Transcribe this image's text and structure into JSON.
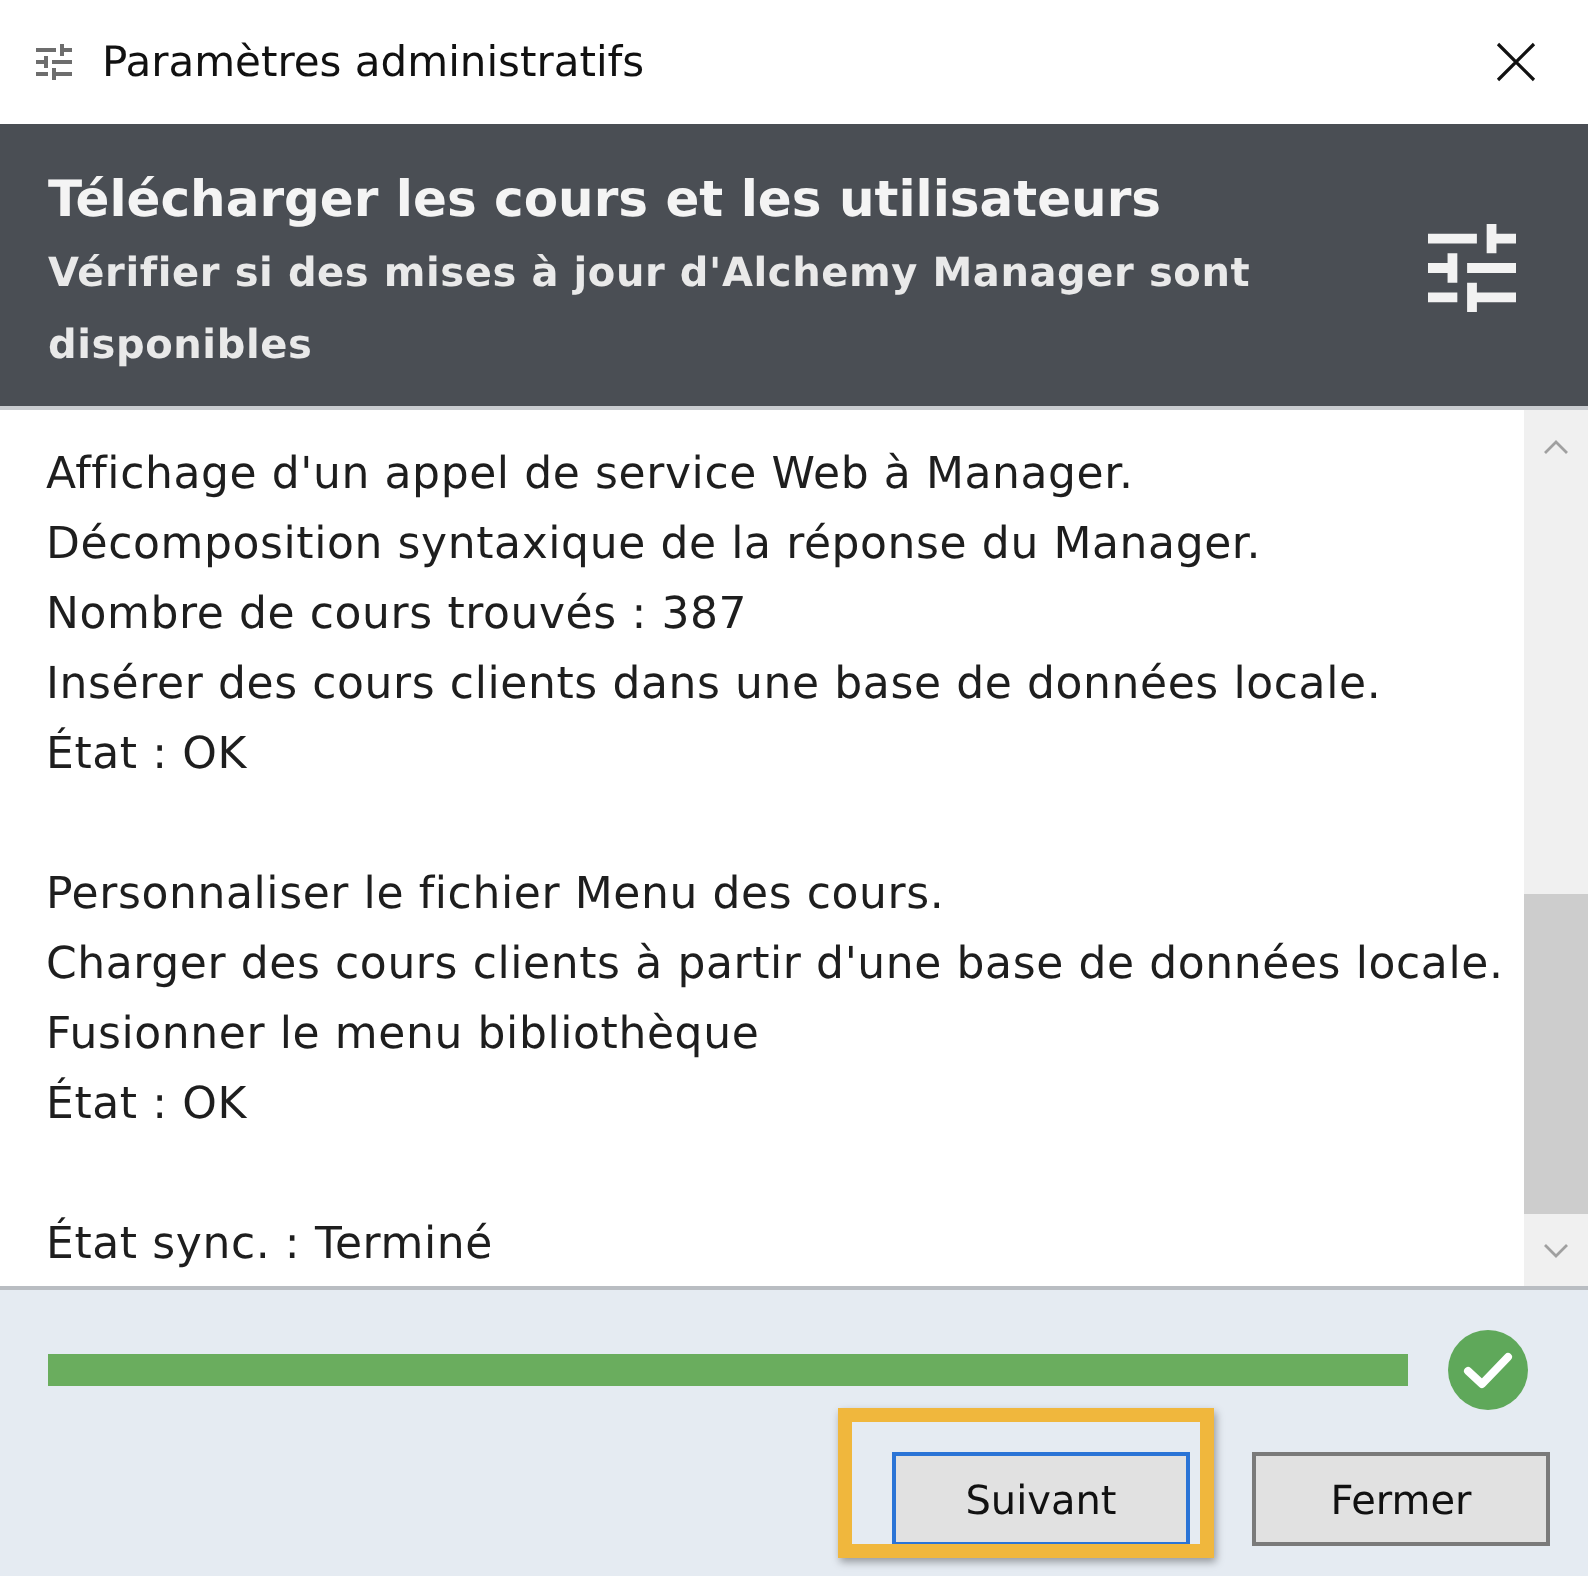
{
  "window": {
    "title": "Paramètres administratifs"
  },
  "header": {
    "title": "Télécharger les cours et les utilisateurs",
    "subtitle": "Vérifier si des mises à jour d'Alchemy Manager sont disponibles"
  },
  "log": {
    "groups": [
      {
        "lines": [
          "Affichage d'un appel de service Web à Manager.",
          "Décomposition syntaxique de la réponse du Manager.",
          "Nombre de cours trouvés : 387",
          "Insérer des cours clients dans une base de données locale.",
          "État : OK"
        ]
      },
      {
        "lines": [
          "Personnaliser le fichier Menu des cours.",
          "Charger des cours clients à partir d'une base de données locale.",
          "Fusionner le menu bibliothèque",
          "État : OK"
        ]
      },
      {
        "lines": [
          "État sync. : Terminé"
        ]
      }
    ]
  },
  "progress": {
    "level": 1,
    "complete": true
  },
  "buttons": [
    {
      "label": "Suivant",
      "focused": true,
      "highlighted": true
    },
    {
      "label": "Fermer",
      "focused": false,
      "highlighted": false
    }
  ]
}
